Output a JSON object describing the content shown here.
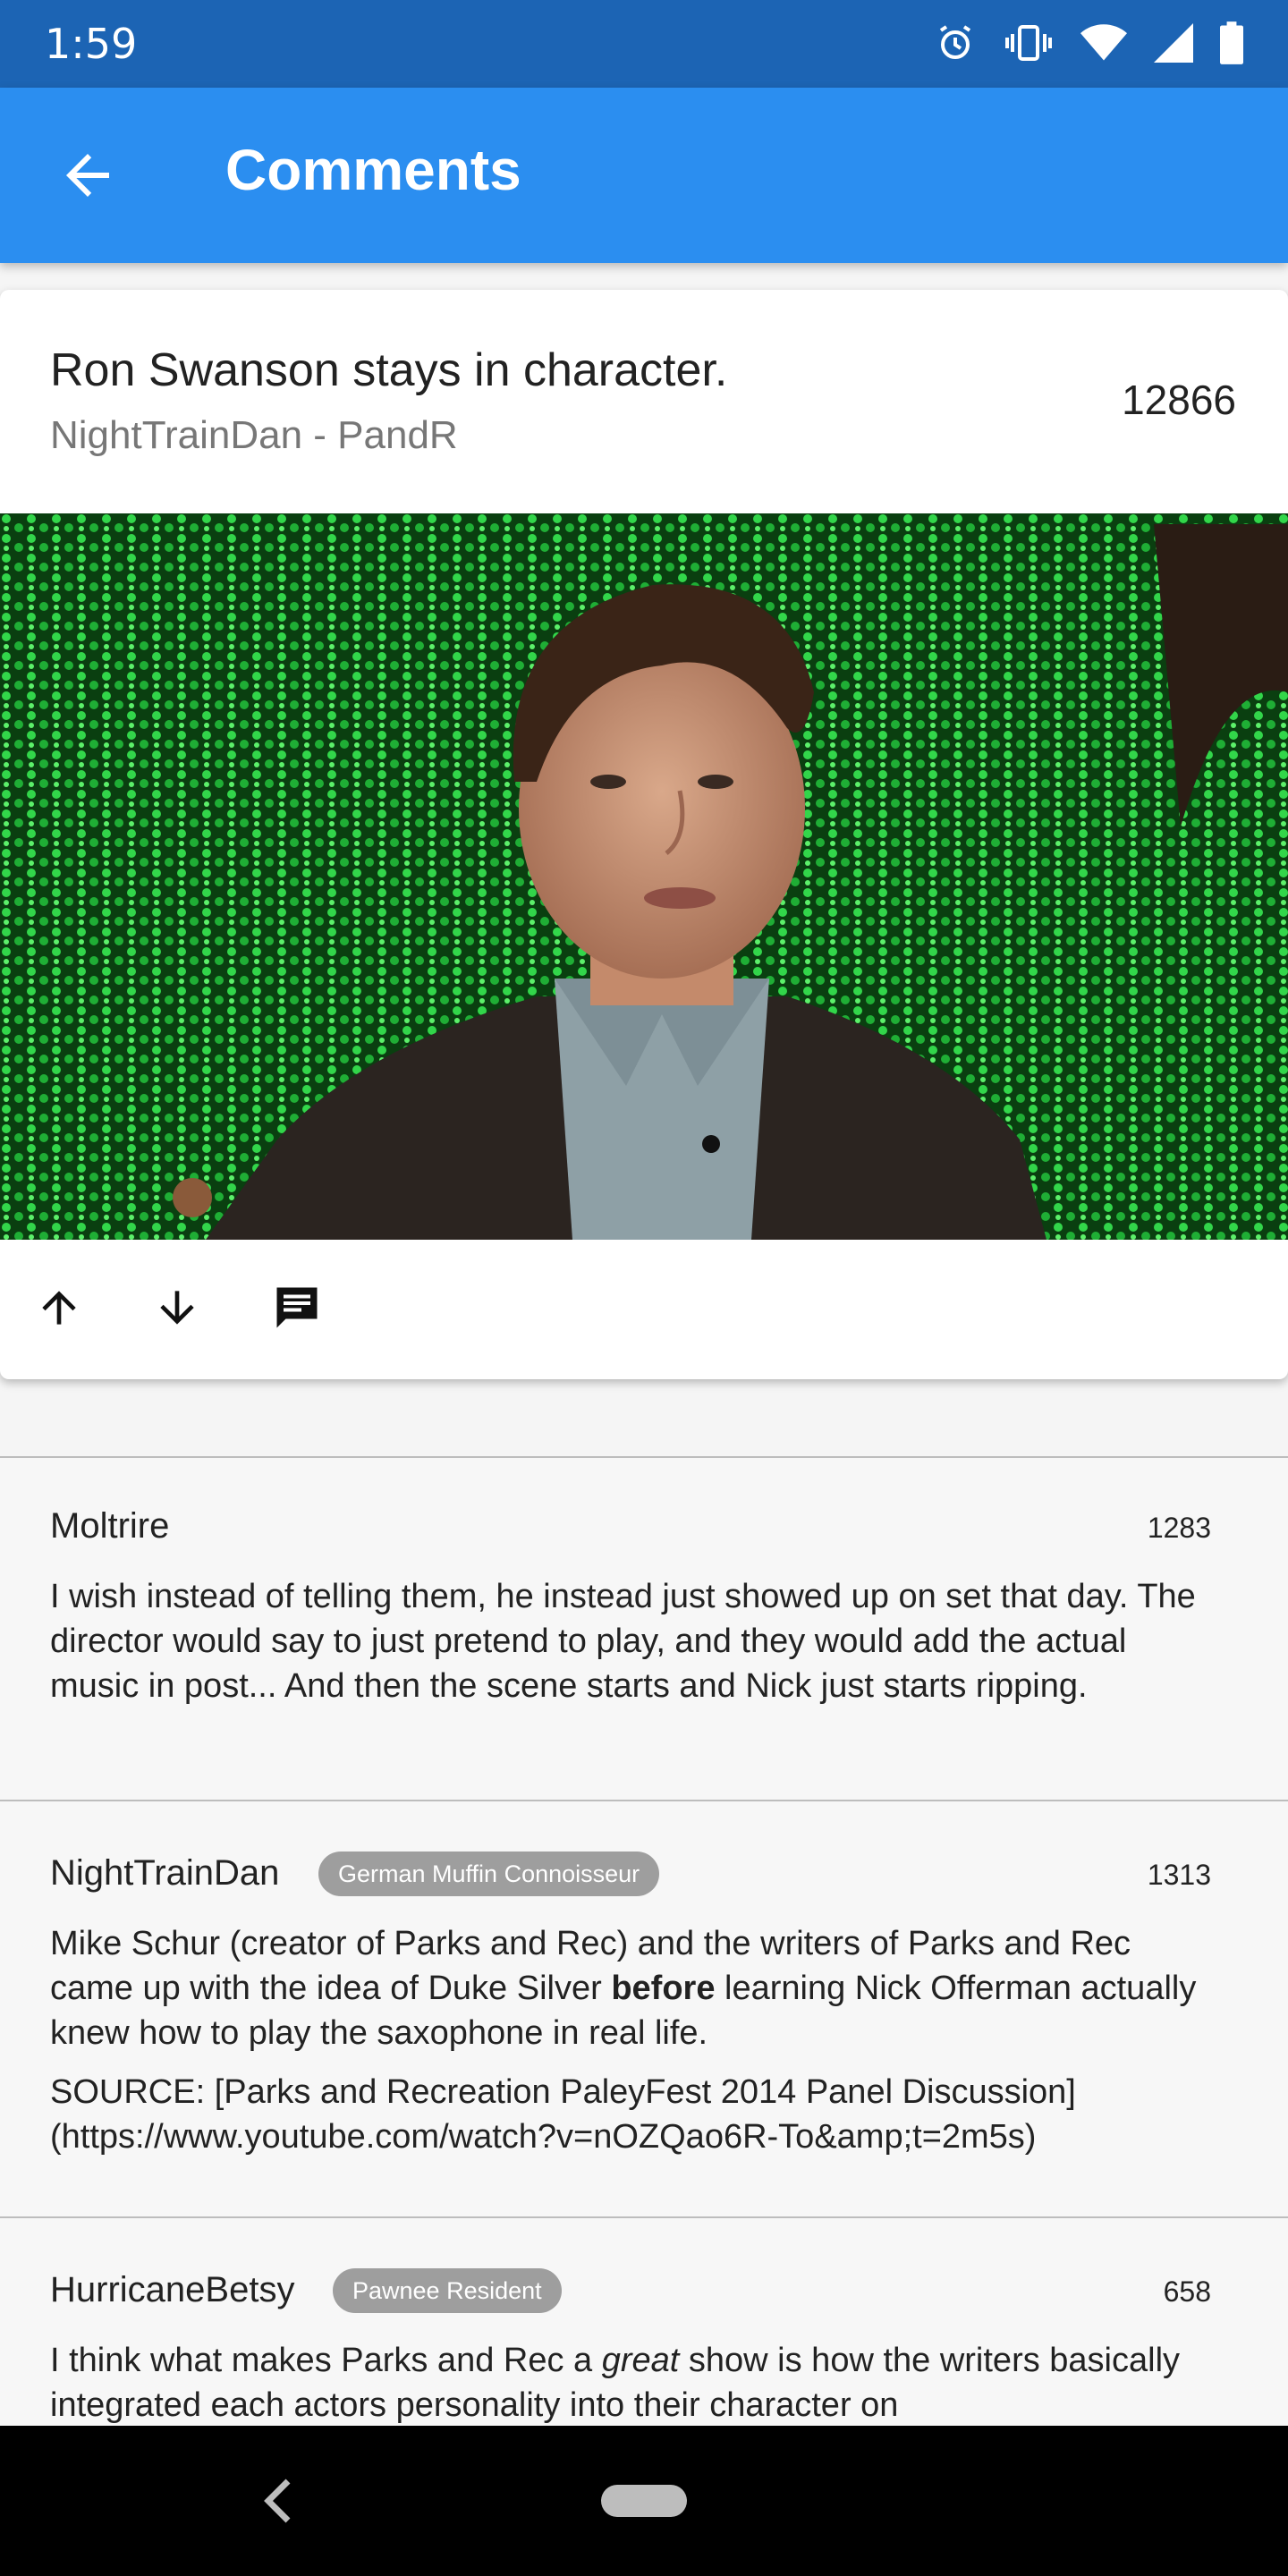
{
  "status_bar": {
    "time": "1:59",
    "icons": [
      "alarm-icon",
      "vibrate-icon",
      "wifi-icon",
      "signal-icon",
      "battery-icon"
    ]
  },
  "app_bar": {
    "title": "Comments",
    "back_icon": "arrow-back-icon",
    "color": "#2b8ef0"
  },
  "post": {
    "title": "Ron Swanson stays in character.",
    "author_subreddit": "NightTrainDan - PandR",
    "score": "12866",
    "actions": [
      "upvote-icon",
      "downvote-icon",
      "comment-icon"
    ]
  },
  "comments": [
    {
      "author": "Moltrire",
      "badge": "",
      "score": "1283",
      "paragraphs": [
        [
          "I wish instead of telling them, he instead just showed up on set that day. The director would say to just pretend to play, and they would add the actual music in post... And then the scene starts and Nick just starts ripping."
        ]
      ]
    },
    {
      "author": "NightTrainDan",
      "badge": "German Muffin Connoisseur",
      "score": "1313",
      "p1_a": "Mike Schur (creator of Parks and Rec) and the  writers of Parks and Rec came up with the idea of Duke Silver ",
      "p1_bold": "before",
      "p1_b": " learning Nick Offerman  actually knew how to play the saxophone in real life.",
      "p2": "SOURCE: [Parks and Recreation PaleyFest 2014 Panel Discussion](https://www.youtube.com/watch?v=nOZQao6R-To&amp;t=2m5s)"
    },
    {
      "author": "HurricaneBetsy",
      "badge": "Pawnee Resident",
      "score": "658",
      "p1_a": "I think what makes Parks and Rec a ",
      "p1_italic": "great",
      "p1_b": " show is how the writers basically integrated each actors personality into their character on"
    }
  ]
}
